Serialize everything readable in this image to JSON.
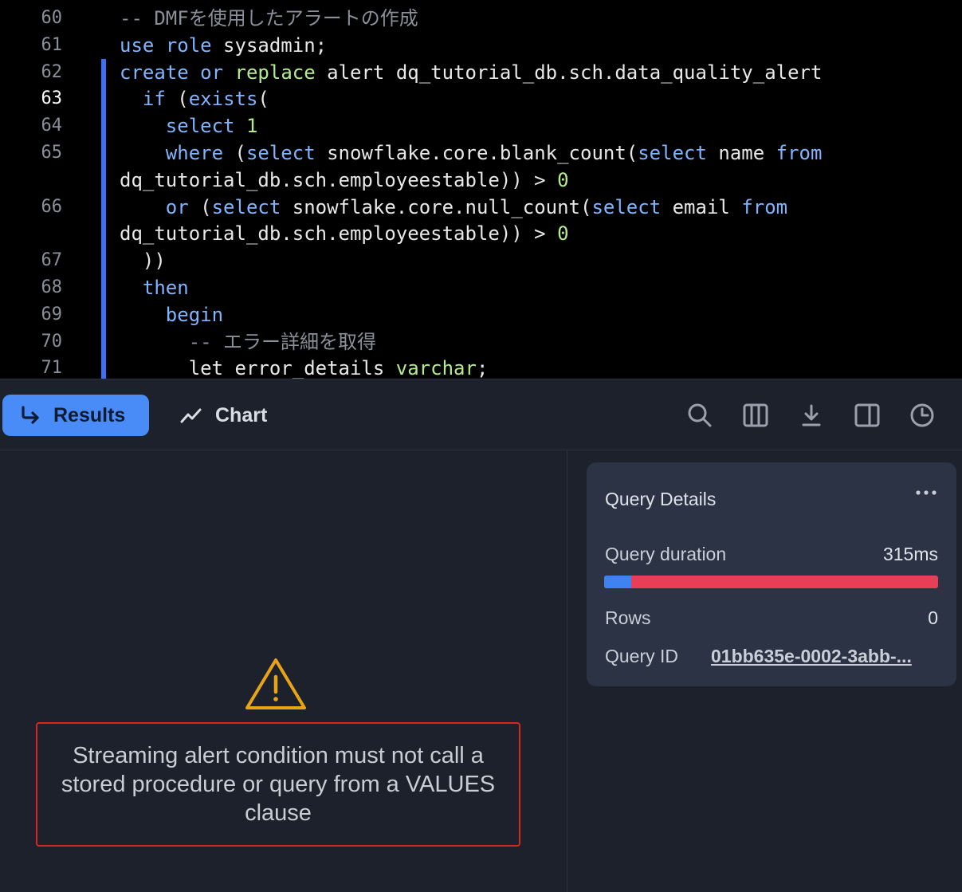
{
  "editor": {
    "lines": [
      {
        "num": "60",
        "changed": false,
        "active": false,
        "tokens": [
          {
            "t": "-- DMFを使用したアラートの作成",
            "c": "cm"
          }
        ]
      },
      {
        "num": "61",
        "changed": false,
        "active": false,
        "tokens": [
          {
            "t": "use",
            "c": "kw"
          },
          {
            "t": " ",
            "c": "id"
          },
          {
            "t": "role",
            "c": "kw"
          },
          {
            "t": " sysadmin;",
            "c": "id"
          }
        ]
      },
      {
        "num": "62",
        "changed": true,
        "active": false,
        "tokens": [
          {
            "t": "create",
            "c": "kw"
          },
          {
            "t": " ",
            "c": "id"
          },
          {
            "t": "or",
            "c": "kw"
          },
          {
            "t": " ",
            "c": "id"
          },
          {
            "t": "replace",
            "c": "fn"
          },
          {
            "t": " alert dq_tutorial_db.sch.data_quality_alert",
            "c": "id"
          }
        ]
      },
      {
        "num": "63",
        "changed": true,
        "active": true,
        "tokens": [
          {
            "t": "  ",
            "c": "id"
          },
          {
            "t": "if",
            "c": "kw"
          },
          {
            "t": " (",
            "c": "id"
          },
          {
            "t": "exists",
            "c": "kw"
          },
          {
            "t": "(",
            "c": "id"
          }
        ]
      },
      {
        "num": "64",
        "changed": true,
        "active": false,
        "tokens": [
          {
            "t": "    ",
            "c": "id"
          },
          {
            "t": "select",
            "c": "kw"
          },
          {
            "t": " ",
            "c": "id"
          },
          {
            "t": "1",
            "c": "num"
          }
        ]
      },
      {
        "num": "65",
        "changed": true,
        "active": false,
        "tokens": [
          {
            "t": "    ",
            "c": "id"
          },
          {
            "t": "where",
            "c": "kw"
          },
          {
            "t": " (",
            "c": "id"
          },
          {
            "t": "select",
            "c": "kw"
          },
          {
            "t": " snowflake.core.blank_count(",
            "c": "id"
          },
          {
            "t": "select",
            "c": "kw"
          },
          {
            "t": " name ",
            "c": "id"
          },
          {
            "t": "from",
            "c": "kw"
          }
        ]
      },
      {
        "num": "",
        "changed": true,
        "active": false,
        "tokens": [
          {
            "t": "dq_tutorial_db.sch.employeestable)) > ",
            "c": "id"
          },
          {
            "t": "0",
            "c": "num"
          }
        ]
      },
      {
        "num": "66",
        "changed": true,
        "active": false,
        "tokens": [
          {
            "t": "    ",
            "c": "id"
          },
          {
            "t": "or",
            "c": "kw"
          },
          {
            "t": " (",
            "c": "id"
          },
          {
            "t": "select",
            "c": "kw"
          },
          {
            "t": " snowflake.core.null_count(",
            "c": "id"
          },
          {
            "t": "select",
            "c": "kw"
          },
          {
            "t": " email ",
            "c": "id"
          },
          {
            "t": "from",
            "c": "kw"
          }
        ]
      },
      {
        "num": "",
        "changed": true,
        "active": false,
        "tokens": [
          {
            "t": "dq_tutorial_db.sch.employeestable)) > ",
            "c": "id"
          },
          {
            "t": "0",
            "c": "num"
          }
        ]
      },
      {
        "num": "67",
        "changed": true,
        "active": false,
        "tokens": [
          {
            "t": "  ))",
            "c": "id"
          }
        ]
      },
      {
        "num": "68",
        "changed": true,
        "active": false,
        "tokens": [
          {
            "t": "  ",
            "c": "id"
          },
          {
            "t": "then",
            "c": "kw"
          }
        ]
      },
      {
        "num": "69",
        "changed": true,
        "active": false,
        "tokens": [
          {
            "t": "    ",
            "c": "id"
          },
          {
            "t": "begin",
            "c": "kw"
          }
        ]
      },
      {
        "num": "70",
        "changed": true,
        "active": false,
        "tokens": [
          {
            "t": "      ",
            "c": "id"
          },
          {
            "t": "-- エラー詳細を取得",
            "c": "cm"
          }
        ]
      },
      {
        "num": "71",
        "changed": true,
        "active": false,
        "tokens": [
          {
            "t": "      let error_details ",
            "c": "id"
          },
          {
            "t": "varchar",
            "c": "fn"
          },
          {
            "t": ";",
            "c": "id"
          }
        ]
      }
    ]
  },
  "toolbar": {
    "results_label": "Results",
    "chart_label": "Chart",
    "icons": [
      "search-icon",
      "columns-icon",
      "download-icon",
      "sidebar-toggle-icon",
      "history-icon"
    ]
  },
  "results": {
    "error_message": "Streaming alert condition must not call a stored procedure or query from a VALUES clause"
  },
  "details": {
    "title": "Query Details",
    "duration_label": "Query duration",
    "duration_value": "315ms",
    "duration_bar_fraction": 0.08,
    "rows_label": "Rows",
    "rows_value": "0",
    "query_id_label": "Query ID",
    "query_id_value": "01bb635e-0002-3abb-..."
  },
  "colors": {
    "accent": "#4a8cf7",
    "error_border": "#d6281f",
    "warning": "#e8a317",
    "bar_blue": "#3f82f1",
    "bar_red": "#ea3d58"
  }
}
